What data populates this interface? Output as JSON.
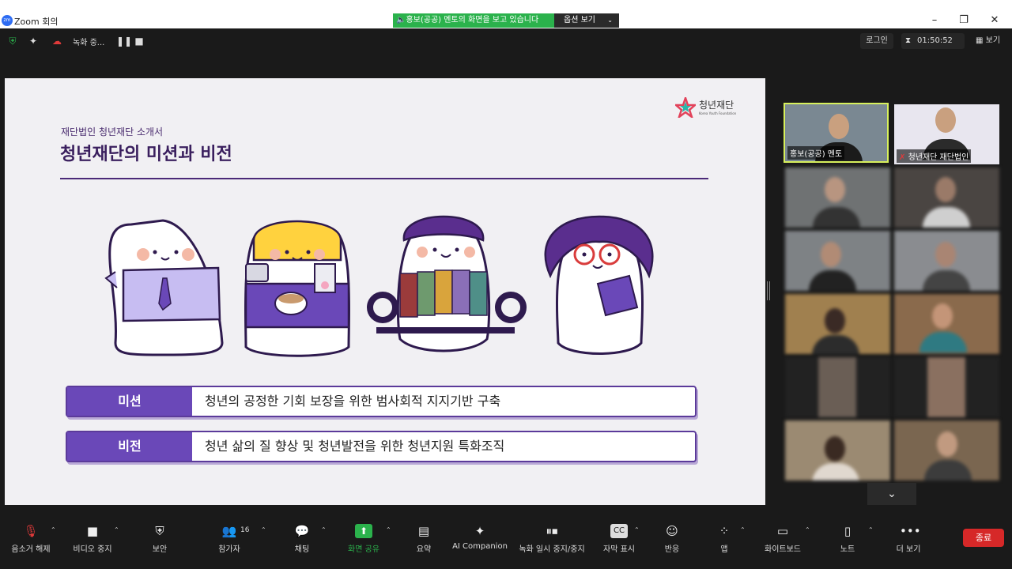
{
  "window": {
    "title": "Zoom 회의",
    "logo_text": "zm"
  },
  "banner": {
    "sharing_text": "🔈홍보(공공) 멘토의 화면을 보고 있습니다",
    "options_label": "옵션 보기"
  },
  "topbar": {
    "recording_text": "녹화 중...",
    "login_label": "로그인",
    "timer": "01:50:52",
    "view_label": "보기"
  },
  "slide": {
    "subtitle": "재단법인 청년재단 소개서",
    "title": "청년재단의 미션과 비전",
    "logo_name": "청년재단",
    "logo_sub": "Korea Youth Foundation",
    "rows": [
      {
        "label": "미션",
        "text": "청년의 공정한 기회 보장을 위한 범사회적 지지기반 구축"
      },
      {
        "label": "비전",
        "text": "청년 삶의 질 향상 및 청년발전을 위한 청년지원 특화조직"
      }
    ]
  },
  "participants": [
    {
      "name": "홍보(공공) 멘토",
      "active": true
    },
    {
      "name": "청년재단 재단법인",
      "muted": true
    }
  ],
  "toolbar": {
    "items": [
      {
        "label": "음소거 해제",
        "icon": "microphone-muted-icon"
      },
      {
        "label": "비디오 중지",
        "icon": "video-camera-icon"
      },
      {
        "label": "보안",
        "icon": "shield-icon"
      },
      {
        "label": "참가자",
        "icon": "participants-icon",
        "count": "16"
      },
      {
        "label": "채팅",
        "icon": "chat-icon"
      },
      {
        "label": "화면 공유",
        "icon": "share-screen-icon"
      },
      {
        "label": "요약",
        "icon": "summary-icon"
      },
      {
        "label": "AI Companion",
        "icon": "sparkle-icon"
      },
      {
        "label": "녹화 일시 중지/중지",
        "icon": "record-controls-icon"
      },
      {
        "label": "자막 표시",
        "icon": "cc-icon"
      },
      {
        "label": "반응",
        "icon": "emoji-icon"
      },
      {
        "label": "앱",
        "icon": "apps-icon"
      },
      {
        "label": "화이트보드",
        "icon": "whiteboard-icon"
      },
      {
        "label": "노트",
        "icon": "notes-icon"
      },
      {
        "label": "더 보기",
        "icon": "more-icon"
      }
    ],
    "end_label": "종료"
  },
  "colors": {
    "accent_green": "#2bb24c",
    "end_red": "#d62828",
    "slide_purple": "#6a48b8"
  }
}
